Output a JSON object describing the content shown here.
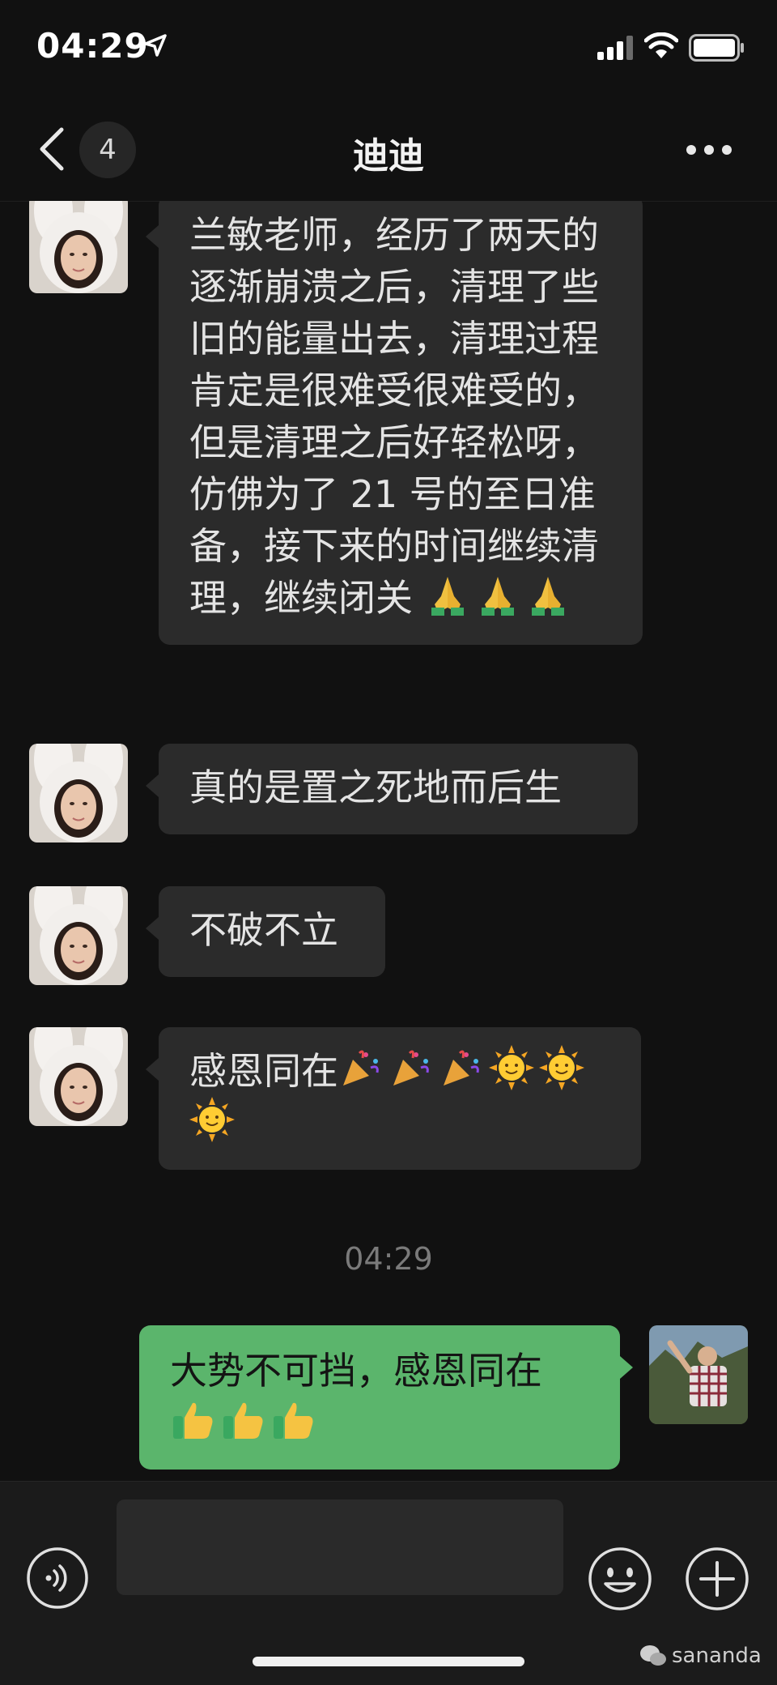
{
  "status": {
    "time": "04:29"
  },
  "header": {
    "unread_count": "4",
    "title": "迪迪"
  },
  "messages": [
    {
      "text": "兰敏老师，经历了两天的逐渐崩溃之后，清理了些旧的能量出去，清理过程肯定是很难受很难受的，但是清理之后好轻松呀，仿佛为了 21 号的至日准备，接下来的时间继续清理，继续闭关",
      "emojis": [
        "folded-hands",
        "folded-hands",
        "folded-hands"
      ]
    },
    {
      "text": "真的是置之死地而后生"
    },
    {
      "text": "不破不立"
    },
    {
      "text": "感恩同在",
      "emojis": [
        "party-popper",
        "party-popper",
        "party-popper",
        "sun-face",
        "sun-face",
        "sun-face"
      ]
    }
  ],
  "timestamp": "04:29",
  "my_message": {
    "text": "大势不可挡，感恩同在",
    "emojis": [
      "thumbs-up",
      "thumbs-up",
      "thumbs-up"
    ]
  },
  "input": {
    "placeholder": ""
  },
  "watermark": "sananda",
  "colors": {
    "background": "#111111",
    "bubble_other": "#2b2b2b",
    "bubble_self": "#5bb56c"
  }
}
